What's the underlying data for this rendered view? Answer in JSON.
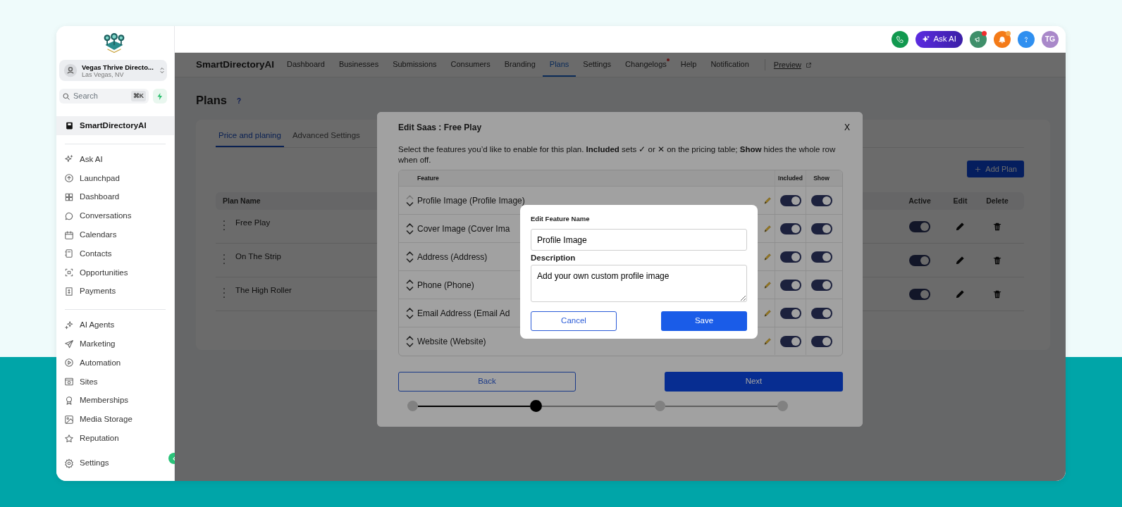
{
  "sidebar": {
    "account": {
      "name": "Vegas Thrive Directo...",
      "location": "Las Vegas, NV"
    },
    "search": {
      "placeholder": "Search",
      "shortcut": "⌘K"
    },
    "pinned": {
      "label": "SmartDirectoryAI",
      "selected": true
    },
    "groups": [
      [
        "Ask AI",
        "Launchpad",
        "Dashboard",
        "Conversations",
        "Calendars",
        "Contacts",
        "Opportunities",
        "Payments"
      ],
      [
        "AI Agents",
        "Marketing",
        "Automation",
        "Sites",
        "Memberships",
        "Media Storage",
        "Reputation"
      ]
    ],
    "settings": "Settings"
  },
  "topbar": {
    "ask_ai": "Ask AI",
    "avatar": "TG"
  },
  "nav": {
    "brand": "SmartDirectoryAI",
    "items": [
      {
        "label": "Dashboard",
        "selected": false,
        "dot": false
      },
      {
        "label": "Businesses",
        "selected": false,
        "dot": false
      },
      {
        "label": "Submissions",
        "selected": false,
        "dot": false
      },
      {
        "label": "Consumers",
        "selected": false,
        "dot": false
      },
      {
        "label": "Branding",
        "selected": false,
        "dot": false
      },
      {
        "label": "Plans",
        "selected": true,
        "dot": false
      },
      {
        "label": "Settings",
        "selected": false,
        "dot": false
      },
      {
        "label": "Changelogs",
        "selected": false,
        "dot": true
      },
      {
        "label": "Help",
        "selected": false,
        "dot": false
      },
      {
        "label": "Notification",
        "selected": false,
        "dot": false
      }
    ],
    "preview": "Preview"
  },
  "page": {
    "title": "Plans",
    "help": "?",
    "tabs": [
      {
        "label": "Price and planing",
        "selected": true
      },
      {
        "label": "Advanced Settings",
        "selected": false
      }
    ],
    "add_button": "Add Plan",
    "columns": [
      "Plan Name",
      "Active",
      "Edit",
      "Delete"
    ],
    "plans": [
      {
        "name": "Free Play",
        "active": true
      },
      {
        "name": "On The Strip",
        "active": true
      },
      {
        "name": "The High Roller",
        "active": true
      }
    ]
  },
  "modal": {
    "title": "Edit Saas : Free Play",
    "close": "X",
    "intro": "Select the features you’d like to enable for this plan. **Included** sets ✓ or ✕ on the pricing table; **Show** hides the whole row when off.",
    "columns": [
      "Feature",
      "Included",
      "Show"
    ],
    "features": [
      {
        "name": "Profile Image (Profile Image)",
        "up_enabled": false,
        "included": true,
        "show": true
      },
      {
        "name": "Cover Image (Cover Ima",
        "up_enabled": true,
        "included": true,
        "show": true
      },
      {
        "name": "Address (Address)",
        "up_enabled": true,
        "included": true,
        "show": true
      },
      {
        "name": "Phone (Phone)",
        "up_enabled": true,
        "included": true,
        "show": true
      },
      {
        "name": "Email Address (Email Ad",
        "up_enabled": true,
        "included": true,
        "show": true
      },
      {
        "name": "Website (Website)",
        "up_enabled": true,
        "included": true,
        "show": true
      }
    ],
    "back": "Back",
    "next": "Next",
    "steps": [
      {
        "selected": false
      },
      {
        "selected": true
      },
      {
        "selected": false
      },
      {
        "selected": false
      }
    ]
  },
  "dialog": {
    "title": "Edit Feature Name",
    "name_value": "Profile Image",
    "description_label": "Description",
    "description_value": "Add your own custom profile image",
    "cancel": "Cancel",
    "save": "Save"
  }
}
